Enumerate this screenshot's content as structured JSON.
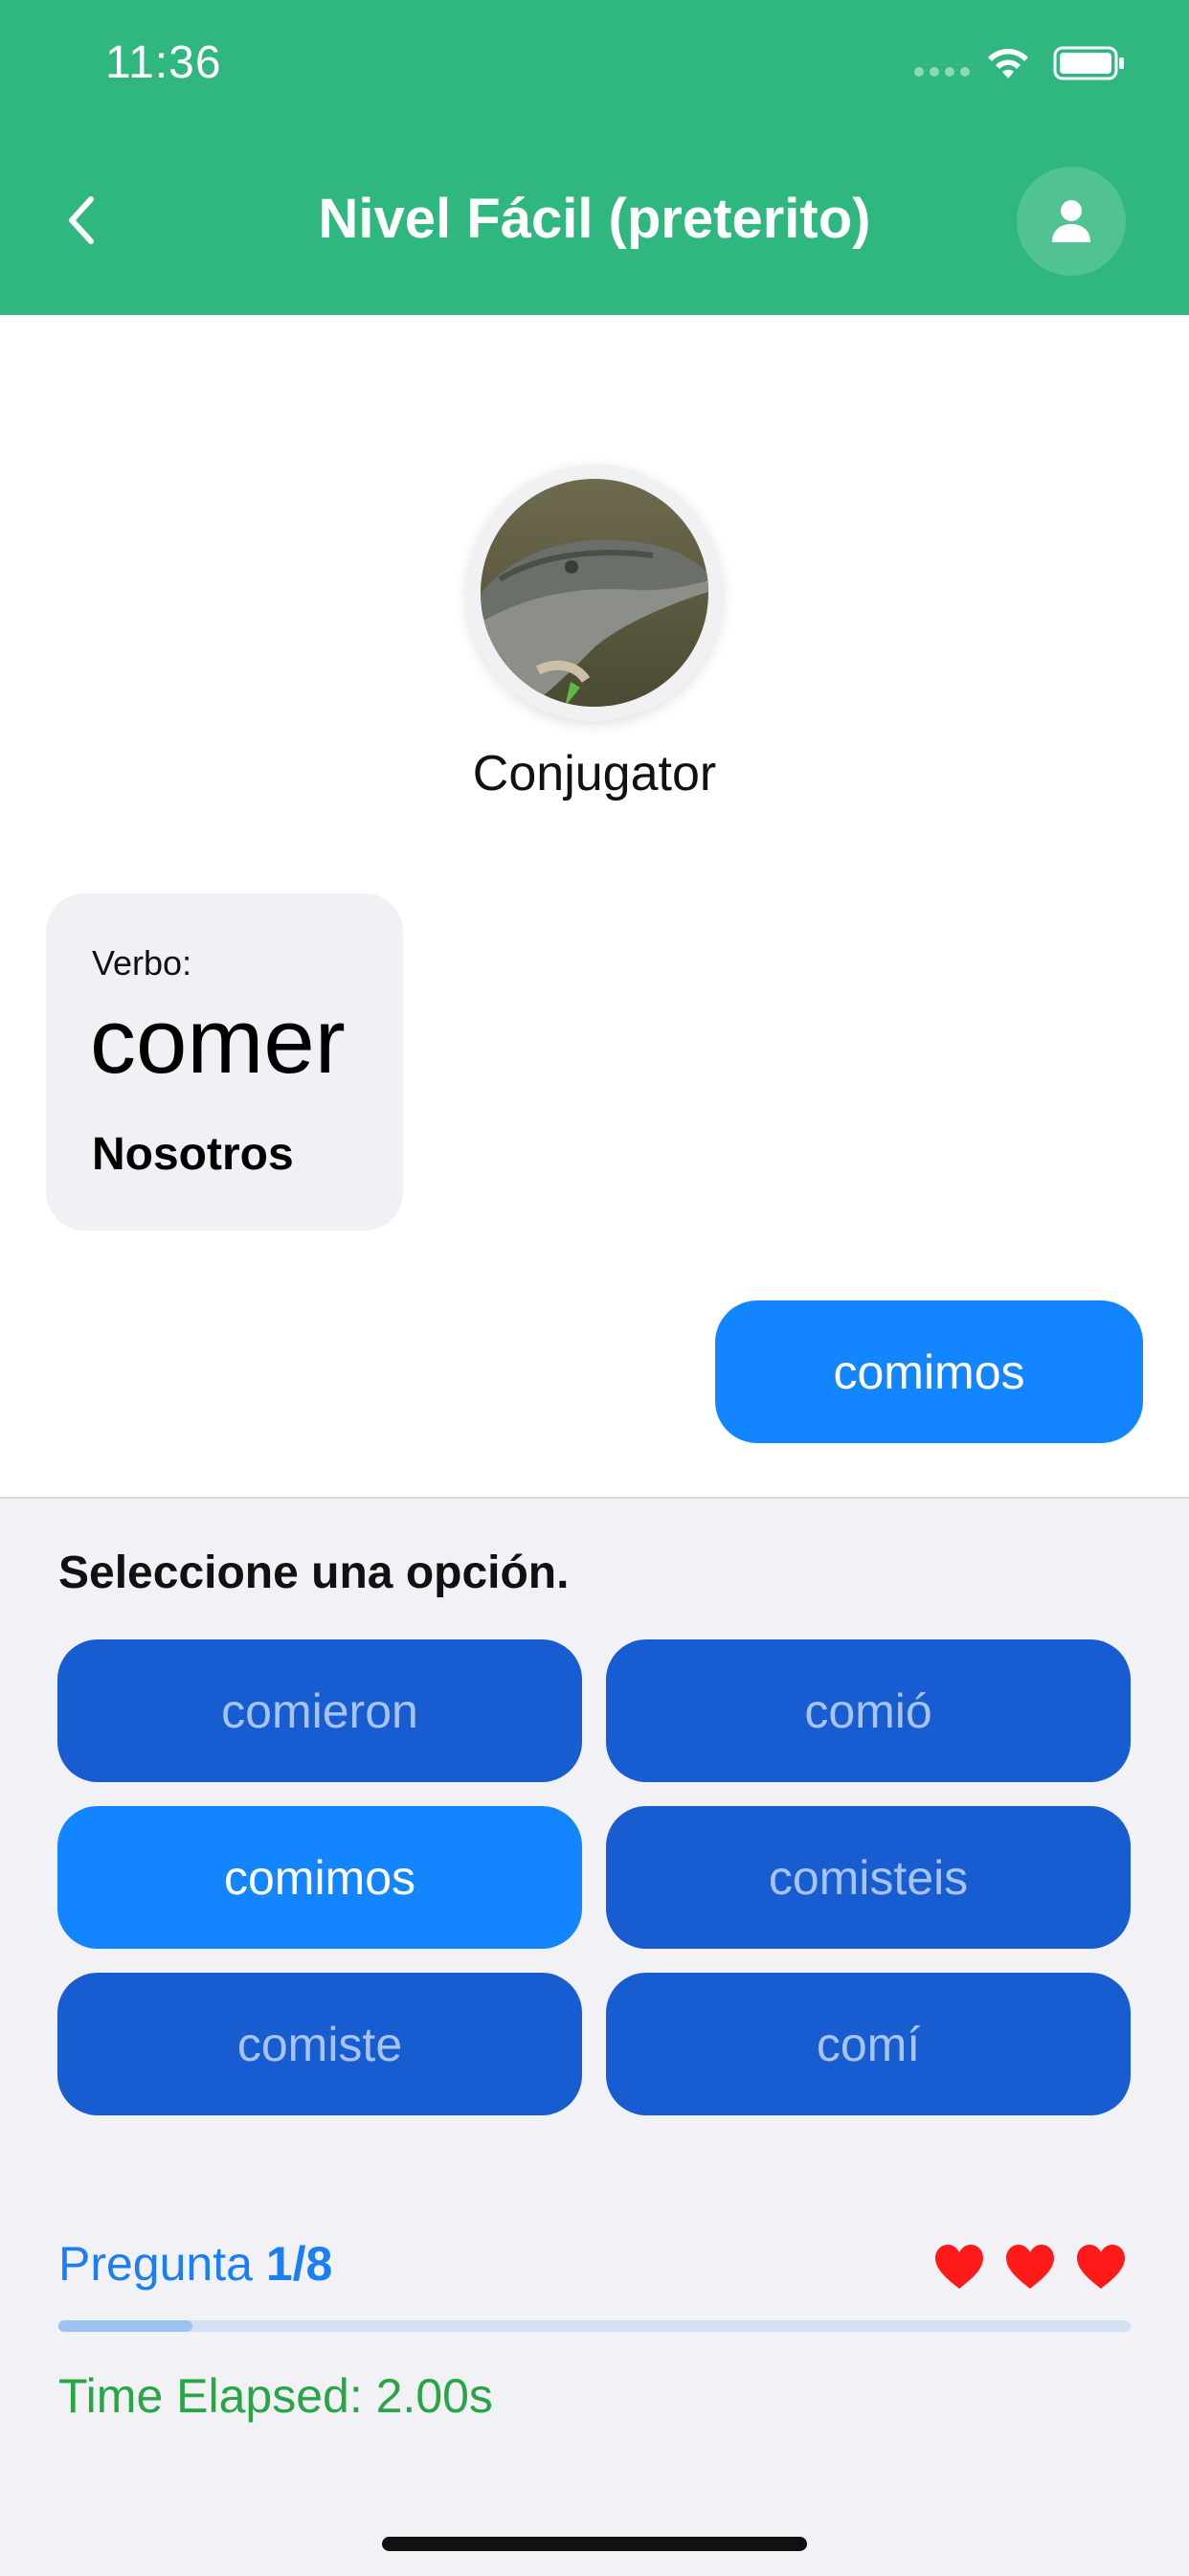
{
  "status_bar": {
    "time": "11:36"
  },
  "header": {
    "title": "Nivel Fácil (preterito)",
    "color": "#2fb77f"
  },
  "bot": {
    "name": "Conjugator"
  },
  "verb_card": {
    "label": "Verbo:",
    "verb": "comer",
    "subject": "Nosotros"
  },
  "answer": {
    "text": "comimos"
  },
  "quiz": {
    "prompt": "Seleccione una opción.",
    "options": [
      {
        "label": "comieron",
        "selected": false
      },
      {
        "label": "comió",
        "selected": false
      },
      {
        "label": "comimos",
        "selected": true
      },
      {
        "label": "comisteis",
        "selected": false
      },
      {
        "label": "comiste",
        "selected": false
      },
      {
        "label": "comí",
        "selected": false
      }
    ]
  },
  "progress": {
    "label": "Pregunta",
    "count": "1/8",
    "fraction": 0.125,
    "lives": 3,
    "timer": "Time Elapsed: 2.00s"
  },
  "colors": {
    "accent": "#1386ff",
    "option": "#185cd2",
    "heart": "#ff1a1a",
    "timer": "#28a545"
  }
}
